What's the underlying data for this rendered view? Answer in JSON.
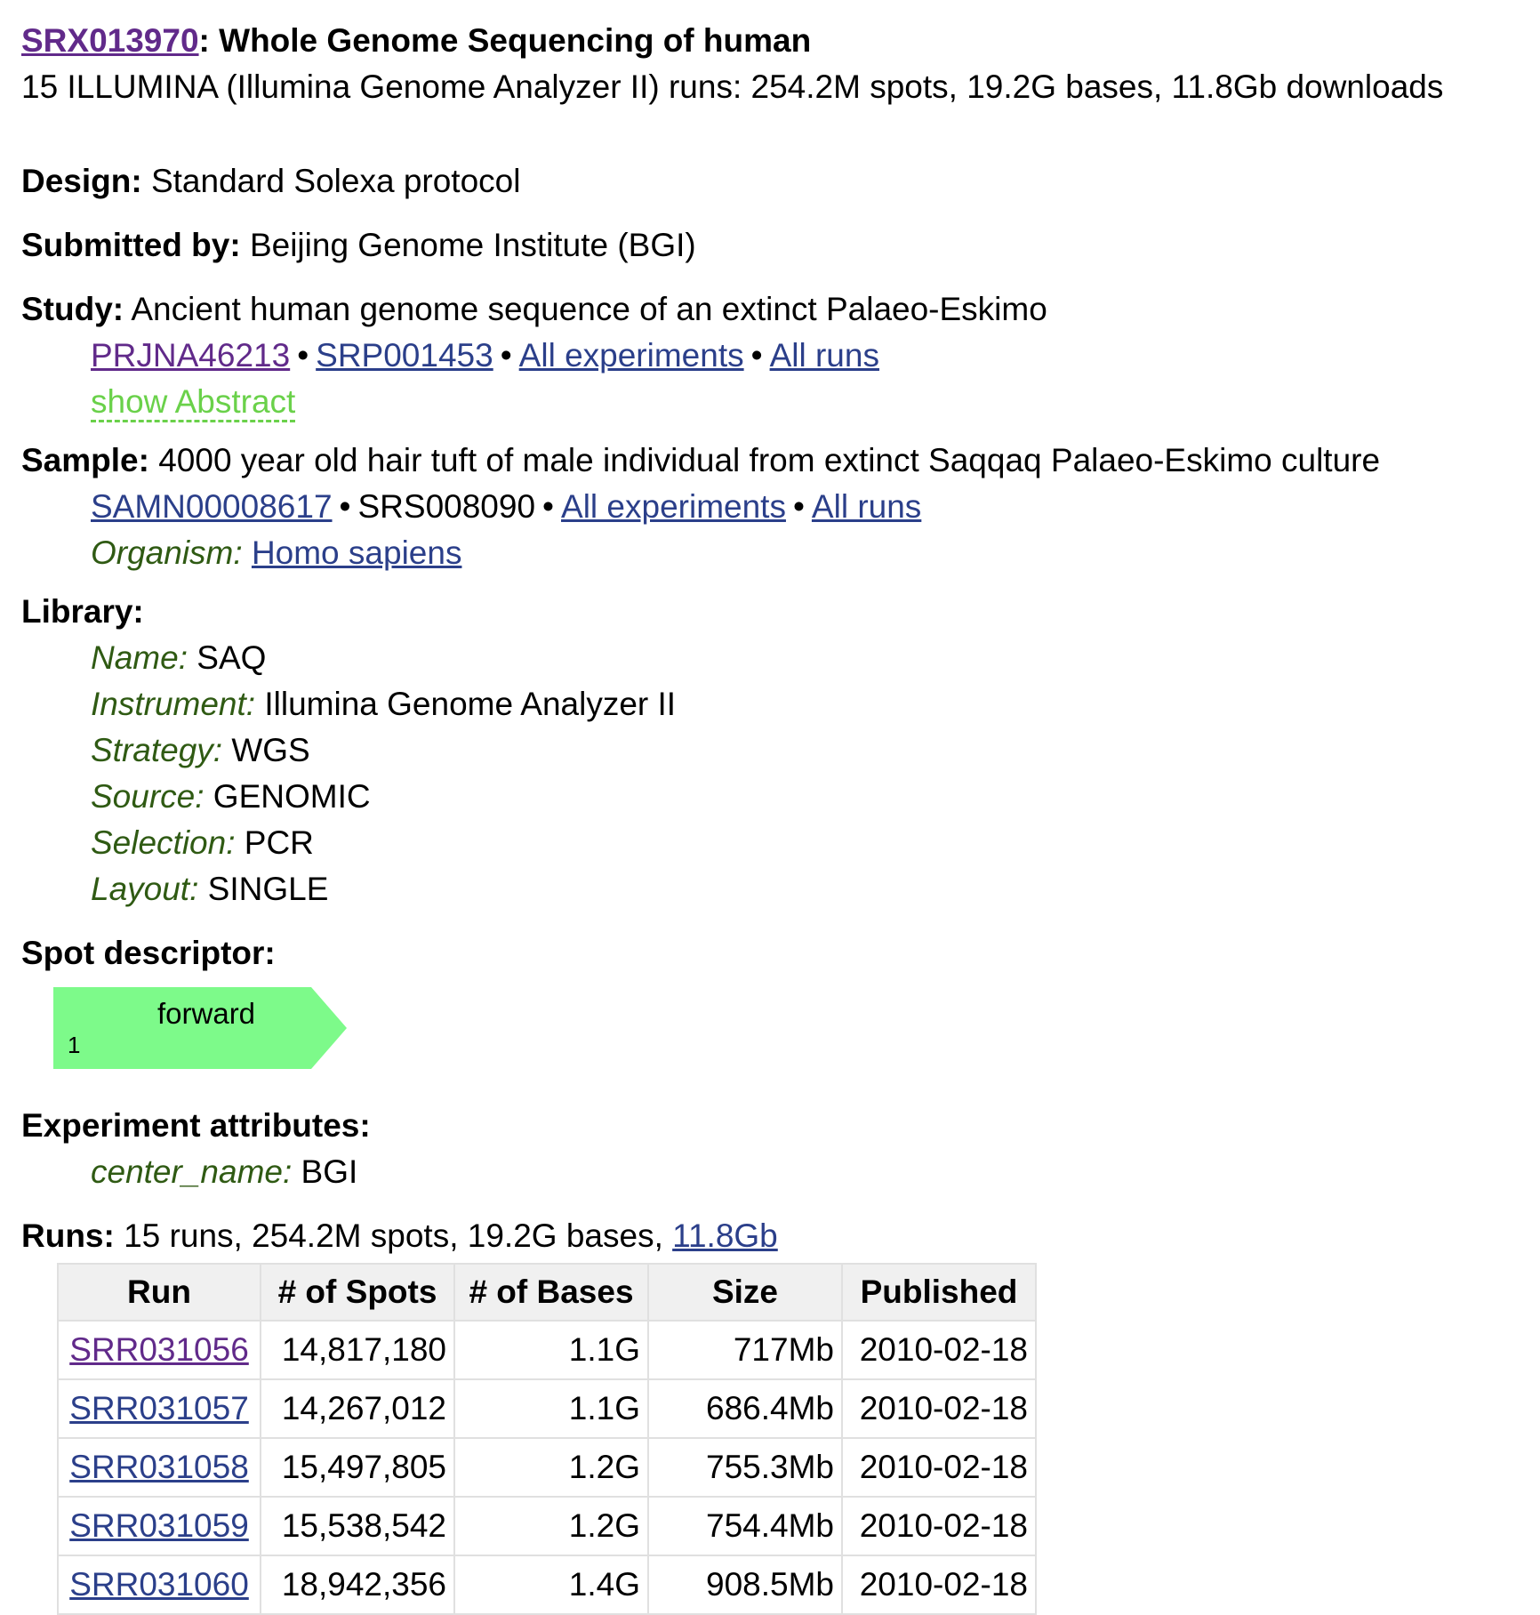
{
  "header": {
    "accession": "SRX013970",
    "title_rest": ": Whole Genome Sequencing of human",
    "summary": "15 ILLUMINA (Illumina Genome Analyzer II) runs: 254.2M spots, 19.2G bases, 11.8Gb downloads"
  },
  "design": {
    "label": "Design:",
    "value": " Standard Solexa protocol"
  },
  "submitted": {
    "label": "Submitted by:",
    "value": " Beijing Genome Institute (BGI)"
  },
  "study": {
    "label": "Study:",
    "value": " Ancient human genome sequence of an extinct Palaeo-Eskimo",
    "bioproject": "PRJNA46213",
    "srp": "SRP001453",
    "all_experiments": "All experiments",
    "all_runs": "All runs",
    "show_abstract": "show Abstract",
    "bullet": "•"
  },
  "sample": {
    "label": "Sample:",
    "value": " 4000 year old hair tuft of male individual from extinct Saqqaq Palaeo-Eskimo culture",
    "biosample": "SAMN00008617",
    "srs": "SRS008090",
    "all_experiments": "All experiments",
    "all_runs": "All runs",
    "organism_label": "Organism:",
    "organism": "Homo sapiens",
    "bullet": "•"
  },
  "library": {
    "label": "Library:",
    "name_label": "Name:",
    "name": " SAQ",
    "instrument_label": "Instrument:",
    "instrument": " Illumina Genome Analyzer II",
    "strategy_label": "Strategy:",
    "strategy": " WGS",
    "source_label": "Source:",
    "source": " GENOMIC",
    "selection_label": "Selection:",
    "selection": " PCR",
    "layout_label": "Layout:",
    "layout": " SINGLE"
  },
  "spot_descriptor": {
    "label": "Spot descriptor:",
    "read_label": "forward",
    "read_start": "1",
    "color": "#7dfa8a"
  },
  "attributes": {
    "label": "Experiment attributes:",
    "center_label": "center_name:",
    "center_value": " BGI"
  },
  "runs": {
    "label": "Runs:",
    "summary": " 15 runs, 254.2M spots, 19.2G bases, ",
    "download": "11.8Gb",
    "columns": [
      "Run",
      "# of Spots",
      "# of Bases",
      "Size",
      "Published"
    ],
    "rows": [
      {
        "run": "SRR031056",
        "spots": "14,817,180",
        "bases": "1.1G",
        "size": "717Mb",
        "published": "2010-02-18"
      },
      {
        "run": "SRR031057",
        "spots": "14,267,012",
        "bases": "1.1G",
        "size": "686.4Mb",
        "published": "2010-02-18"
      },
      {
        "run": "SRR031058",
        "spots": "15,497,805",
        "bases": "1.2G",
        "size": "755.3Mb",
        "published": "2010-02-18"
      },
      {
        "run": "SRR031059",
        "spots": "15,538,542",
        "bases": "1.2G",
        "size": "754.4Mb",
        "published": "2010-02-18"
      },
      {
        "run": "SRR031060",
        "spots": "18,942,356",
        "bases": "1.4G",
        "size": "908.5Mb",
        "published": "2010-02-18"
      }
    ]
  }
}
